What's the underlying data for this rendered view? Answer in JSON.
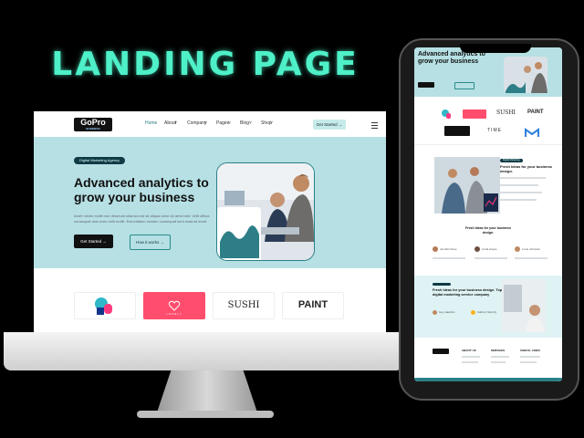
{
  "headline": "LANDING PAGE",
  "desktop": {
    "logo": {
      "main": "GoPro",
      "sub": "BUSINESS"
    },
    "nav": {
      "items": [
        "Home",
        "About",
        "Company",
        "Pages",
        "Blog",
        "Shop"
      ],
      "cta": "Get Started"
    },
    "hero": {
      "badge": "Digital Marketing Agency",
      "title": "Advanced analytics to grow your business",
      "description": "Amet minim mollit non deserunt ullamco est sit aliqua dolor do amet sint. Velit officia consequat duis enim velit mollit. Exercitation veniam consequat sunt nostrud amet.",
      "primary_button": "Get Started",
      "secondary_button": "How it works"
    },
    "brands": [
      "",
      "LOVELY",
      "SUSHI",
      "PAINT"
    ]
  },
  "phone": {
    "hero_title": "Advanced analytics to grow your business",
    "brands": [
      "",
      "",
      "SUSHI",
      "PAINT",
      "",
      "TIME",
      ""
    ],
    "feature_badge": "Digital Marketing",
    "feature_title": "Fresh Ideas for your business design.",
    "ideas_title": "Fresh Ideas for your business design.",
    "people": [
      "Jennifer Rose",
      "Linda Hayes",
      "Lucie Johnston"
    ],
    "service_title": "Fresh Ideas for your business design. Top digital marketing service company",
    "service_people": [
      "Guy Hawkins",
      "Kathryn Murphy"
    ],
    "footer_columns": [
      "ABOUT US",
      "SERVICES",
      "USEFUL LINKS"
    ]
  },
  "colors": {
    "headline": "#4ef0c8",
    "hero_bg": "#b6e0e4",
    "accent_teal": "#2a7f86",
    "dark": "#111111"
  }
}
